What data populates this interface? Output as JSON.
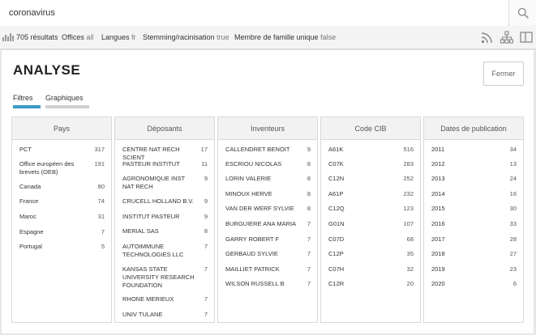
{
  "search": {
    "value": "coronavirus"
  },
  "info_bar": {
    "results": "705 résultats",
    "offices_label": "Offices",
    "offices_value": "all",
    "langues_label": "Langues",
    "langues_value": "fr",
    "stemming_label": "Stemming/racinisation",
    "stemming_value": "true",
    "famille_label": "Membre de famille unique",
    "famille_value": "false"
  },
  "panel": {
    "title": "ANALYSE",
    "close_label": "Fermer",
    "tabs": [
      {
        "label": "Filtres"
      },
      {
        "label": "Graphiques"
      }
    ]
  },
  "columns": [
    {
      "header": "Pays",
      "rows": [
        {
          "name": "PCT",
          "count": "317"
        },
        {
          "name": "Office européen des brevets (OEB)",
          "count": "191"
        },
        {
          "name": "Canada",
          "count": "80"
        },
        {
          "name": "France",
          "count": "74"
        },
        {
          "name": "Maroc",
          "count": "31"
        },
        {
          "name": "Espagne",
          "count": "7"
        },
        {
          "name": "Portugal",
          "count": "5"
        }
      ]
    },
    {
      "header": "Déposants",
      "rows": [
        {
          "name": "CENTRE NAT RECH SCIENT",
          "count": "17"
        },
        {
          "name": "PASTEUR INSTITUT",
          "count": "11"
        },
        {
          "name": "AGRONOMIQUE INST NAT RECH",
          "count": "9"
        },
        {
          "name": "CRUCELL HOLLAND B.V.",
          "count": "9"
        },
        {
          "name": "INSTITUT PASTEUR",
          "count": "9"
        },
        {
          "name": "MERIAL SAS",
          "count": "8"
        },
        {
          "name": "AUTOIMMUNE TECHNOLOGIES LLC",
          "count": "7"
        },
        {
          "name": "KANSAS STATE UNIVERSITY RESEARCH FOUNDATION",
          "count": "7"
        },
        {
          "name": "RHONE MERIEUX",
          "count": "7"
        },
        {
          "name": "UNIV TULANE",
          "count": "7"
        }
      ]
    },
    {
      "header": "Inventeurs",
      "rows": [
        {
          "name": "CALLENDRET BENOIT",
          "count": "9"
        },
        {
          "name": "ESCRIOU NICOLAS",
          "count": "8"
        },
        {
          "name": "LORIN VALERIE",
          "count": "8"
        },
        {
          "name": "MINOUX HERVE",
          "count": "8"
        },
        {
          "name": "VAN DER WERF SYLVIE",
          "count": "8"
        },
        {
          "name": "BURGUIERE ANA MARIA",
          "count": "7"
        },
        {
          "name": "GARRY ROBERT F",
          "count": "7"
        },
        {
          "name": "GERBAUD SYLVIE",
          "count": "7"
        },
        {
          "name": "MAILLIET PATRICK",
          "count": "7"
        },
        {
          "name": "WILSON RUSSELL B",
          "count": "7"
        }
      ]
    },
    {
      "header": "Code CIB",
      "rows": [
        {
          "name": "A61K",
          "count": "516"
        },
        {
          "name": "C07K",
          "count": "283"
        },
        {
          "name": "C12N",
          "count": "252"
        },
        {
          "name": "A61P",
          "count": "232"
        },
        {
          "name": "C12Q",
          "count": "123"
        },
        {
          "name": "G01N",
          "count": "107"
        },
        {
          "name": "C07D",
          "count": "68"
        },
        {
          "name": "C12P",
          "count": "35"
        },
        {
          "name": "C07H",
          "count": "32"
        },
        {
          "name": "C12R",
          "count": "20"
        }
      ]
    },
    {
      "header": "Dates de publication",
      "rows": [
        {
          "name": "2011",
          "count": "34"
        },
        {
          "name": "2012",
          "count": "13"
        },
        {
          "name": "2013",
          "count": "24"
        },
        {
          "name": "2014",
          "count": "16"
        },
        {
          "name": "2015",
          "count": "30"
        },
        {
          "name": "2016",
          "count": "33"
        },
        {
          "name": "2017",
          "count": "28"
        },
        {
          "name": "2018",
          "count": "27"
        },
        {
          "name": "2019",
          "count": "23"
        },
        {
          "name": "2020",
          "count": "6"
        }
      ]
    }
  ],
  "icons": {
    "search": "search-icon",
    "stats": "bar-chart-icon",
    "rss": "rss-feed-icon",
    "tree": "hierarchy-icon",
    "split": "split-view-icon"
  }
}
